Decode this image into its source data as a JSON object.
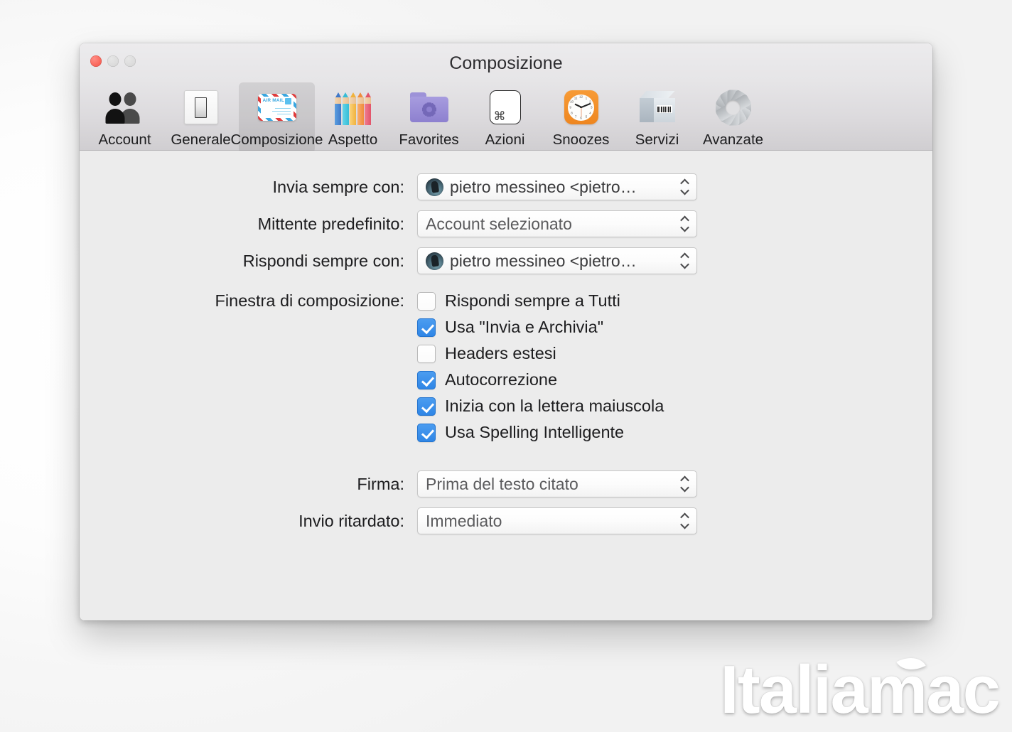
{
  "window": {
    "title": "Composizione",
    "traffic_lights": {
      "close": "close-button",
      "minimize": "minimize-button",
      "zoom": "zoom-button"
    }
  },
  "toolbar": {
    "selected": "Composizione",
    "items": [
      {
        "label": "Account",
        "icon": "people-icon"
      },
      {
        "label": "Generale",
        "icon": "light-switch-icon"
      },
      {
        "label": "Composizione",
        "icon": "airmail-envelope-icon"
      },
      {
        "label": "Aspetto",
        "icon": "colored-pencils-icon"
      },
      {
        "label": "Favorites",
        "icon": "purple-folder-gear-icon"
      },
      {
        "label": "Azioni",
        "icon": "command-key-icon"
      },
      {
        "label": "Snoozes",
        "icon": "orange-clock-icon"
      },
      {
        "label": "Servizi",
        "icon": "barcode-box-icon"
      },
      {
        "label": "Avanzate",
        "icon": "gear-icon"
      }
    ]
  },
  "form": {
    "send_always_with": {
      "label": "Invia sempre con:",
      "value": "pietro messineo <pietro…",
      "has_avatar": true
    },
    "default_sender": {
      "label": "Mittente predefinito:",
      "value": "Account selezionato",
      "has_avatar": false
    },
    "reply_always_with": {
      "label": "Rispondi sempre con:",
      "value": "pietro messineo <pietro…",
      "has_avatar": true
    },
    "compose_window": {
      "label": "Finestra di composizione:",
      "checkboxes": [
        {
          "label": "Rispondi sempre a Tutti",
          "checked": false
        },
        {
          "label": "Usa \"Invia e Archivia\"",
          "checked": true
        },
        {
          "label": "Headers estesi",
          "checked": false
        },
        {
          "label": "Autocorrezione",
          "checked": true
        },
        {
          "label": "Inizia con la lettera maiuscola",
          "checked": true
        },
        {
          "label": "Usa Spelling Intelligente",
          "checked": true
        }
      ]
    },
    "signature": {
      "label": "Firma:",
      "value": "Prima del testo citato",
      "has_avatar": false
    },
    "delayed_send": {
      "label": "Invio ritardato:",
      "value": "Immediato",
      "has_avatar": false
    }
  },
  "watermark": {
    "text": "Italiamac"
  },
  "colors": {
    "checkbox_blue": "#3b8ee8",
    "close_red": "#fa6b60",
    "window_bg": "#ececec",
    "snooze_orange": "#f0881f"
  }
}
